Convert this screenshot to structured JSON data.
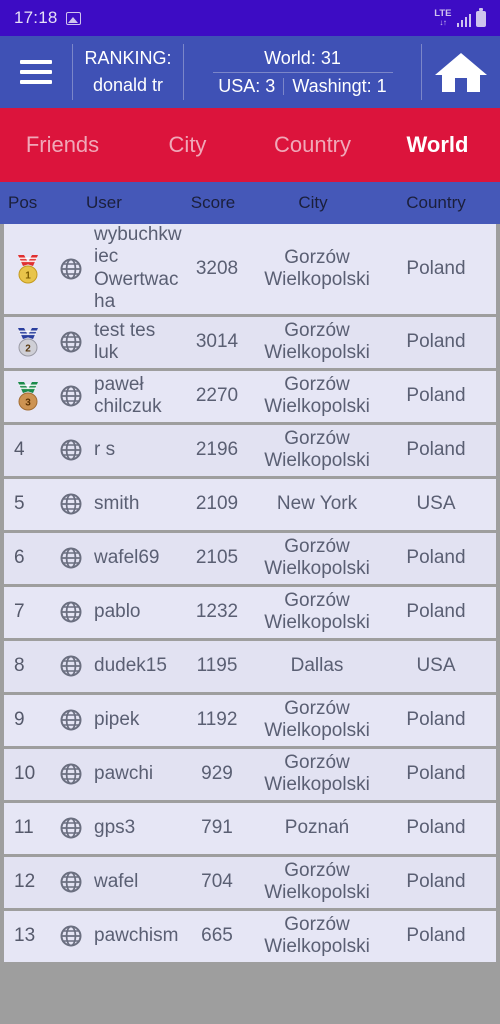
{
  "statusbar": {
    "time": "17:18",
    "photo_icon": "image-icon",
    "network": "LTE",
    "network_arrows": "↓↑",
    "signal_icon": "signal-bars-icon",
    "battery_icon": "battery-icon"
  },
  "appbar": {
    "menu_icon": "hamburger-menu-icon",
    "ranking_label": "RANKING:",
    "ranking_user": "donald tr",
    "world_stat": "World: 31",
    "usa_stat": "USA: 3",
    "city_stat": "Washingt: 1",
    "home_icon": "home-icon"
  },
  "tabs": [
    {
      "label": "Friends",
      "active": false
    },
    {
      "label": "City",
      "active": false
    },
    {
      "label": "Country",
      "active": false
    },
    {
      "label": "World",
      "active": true
    }
  ],
  "table": {
    "headers": {
      "pos": "Pos",
      "user": "User",
      "score": "Score",
      "city": "City",
      "country": "Country"
    },
    "rows": [
      {
        "pos": "1",
        "medal": "gold",
        "icon": "globe-icon",
        "user": "wybuchkwiec Owertwacha",
        "score": "3208",
        "city": "Gorzów Wielkopolski",
        "country": "Poland"
      },
      {
        "pos": "2",
        "medal": "silver",
        "icon": "globe-icon",
        "user": "test tes luk",
        "score": "3014",
        "city": "Gorzów Wielkopolski",
        "country": "Poland"
      },
      {
        "pos": "3",
        "medal": "bronze",
        "icon": "globe-icon",
        "user": "paweł chilczuk",
        "score": "2270",
        "city": "Gorzów Wielkopolski",
        "country": "Poland"
      },
      {
        "pos": "4",
        "medal": null,
        "icon": "globe-icon",
        "user": "r  s",
        "score": "2196",
        "city": "Gorzów Wielkopolski",
        "country": "Poland"
      },
      {
        "pos": "5",
        "medal": null,
        "icon": "globe-icon",
        "user": "smith",
        "score": "2109",
        "city": "New York",
        "country": "USA"
      },
      {
        "pos": "6",
        "medal": null,
        "icon": "globe-icon",
        "user": "wafel69",
        "score": "2105",
        "city": "Gorzów Wielkopolski",
        "country": "Poland"
      },
      {
        "pos": "7",
        "medal": null,
        "icon": "globe-icon",
        "user": "pablo",
        "score": "1232",
        "city": "Gorzów Wielkopolski",
        "country": "Poland"
      },
      {
        "pos": "8",
        "medal": null,
        "icon": "globe-icon",
        "user": "dudek15",
        "score": "1195",
        "city": "Dallas",
        "country": "USA"
      },
      {
        "pos": "9",
        "medal": null,
        "icon": "globe-icon",
        "user": "pipek",
        "score": "1192",
        "city": "Gorzów Wielkopolski",
        "country": "Poland"
      },
      {
        "pos": "10",
        "medal": null,
        "icon": "globe-icon",
        "user": "pawchi",
        "score": "929",
        "city": "Gorzów Wielkopolski",
        "country": "Poland"
      },
      {
        "pos": "11",
        "medal": null,
        "icon": "globe-icon",
        "user": "gps3",
        "score": "791",
        "city": "Poznań",
        "country": "Poland"
      },
      {
        "pos": "12",
        "medal": null,
        "icon": "globe-icon",
        "user": "wafel",
        "score": "704",
        "city": "Gorzów Wielkopolski",
        "country": "Poland"
      },
      {
        "pos": "13",
        "medal": null,
        "icon": "globe-icon",
        "user": "pawchism",
        "score": "665",
        "city": "Gorzów Wielkopolski",
        "country": "Poland"
      }
    ]
  },
  "colors": {
    "statusbar_bg": "#3d0cc4",
    "appbar_bg": "#3f51b5",
    "tabs_bg": "#dc143c",
    "thead_bg": "#4558b8",
    "row_bg": "#e6e6f5",
    "page_bg": "#9e9e9e"
  }
}
